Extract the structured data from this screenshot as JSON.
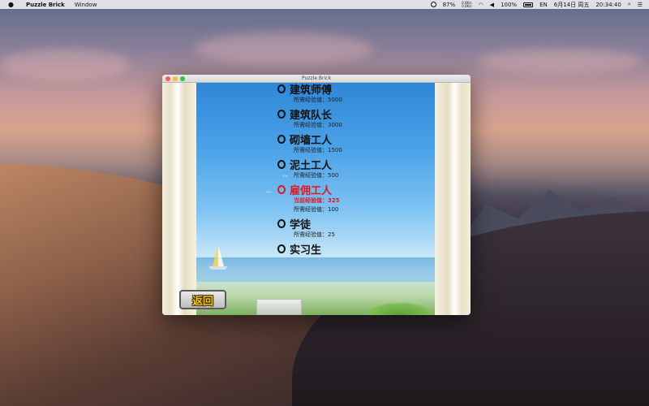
{
  "menubar": {
    "app_name": "Puzzle Brick",
    "menus": [
      "Window"
    ],
    "status": {
      "cpu": "87%",
      "net_up": "0.0K/s",
      "net_down": "0.0K/s",
      "battery": "100%",
      "battery_label": "EN",
      "date": "6月14日 周五",
      "time": "20:34:40"
    }
  },
  "window": {
    "title": "Puzzle Brick"
  },
  "ranks": [
    {
      "name": "建筑师傅",
      "required_label": "所需经验值：5000",
      "current": false
    },
    {
      "name": "建筑队长",
      "required_label": "所需经验值：3000",
      "current": false
    },
    {
      "name": "砌墙工人",
      "required_label": "所需经验值：1500",
      "current": false
    },
    {
      "name": "泥土工人",
      "required_label": "所需经验值：500",
      "current": false
    },
    {
      "name": "雇佣工人",
      "current_label": "当前经验值：325",
      "required_label": "所需经验值：100",
      "current": true
    },
    {
      "name": "学徒",
      "required_label": "所需经验值：25",
      "current": false
    },
    {
      "name": "实习生",
      "current": false
    }
  ],
  "back_button": {
    "label": "返回"
  },
  "colors": {
    "current_rank": "#e3161d",
    "rank_text": "#111111",
    "button_text": "#f2c21a"
  }
}
